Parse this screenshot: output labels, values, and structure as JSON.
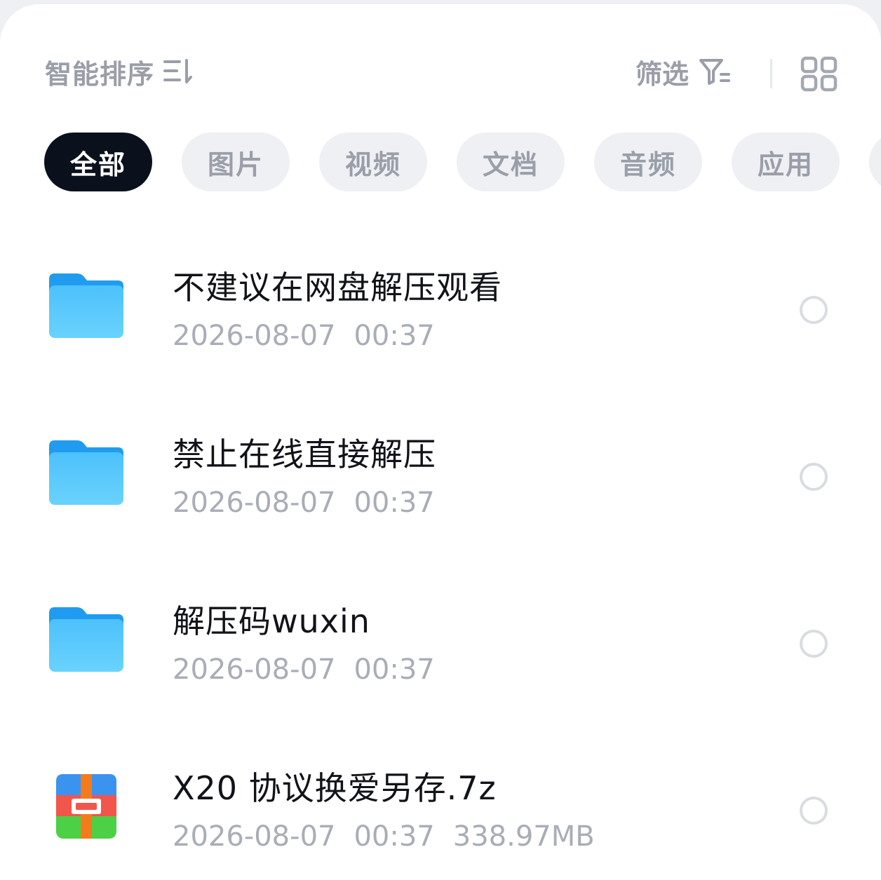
{
  "toolbar": {
    "sort_label": "智能排序",
    "sort_icon": "sort-order-icon",
    "filter_label": "筛选",
    "filter_icon": "filter-icon",
    "view_toggle_icon": "grid-view-icon"
  },
  "categories": [
    {
      "label": "全部",
      "active": true
    },
    {
      "label": "图片",
      "active": false
    },
    {
      "label": "视频",
      "active": false
    },
    {
      "label": "文档",
      "active": false
    },
    {
      "label": "音频",
      "active": false
    },
    {
      "label": "应用",
      "active": false
    }
  ],
  "files": [
    {
      "name": "不建议在网盘解压观看",
      "date": "2026-08-07",
      "time": "00:37",
      "size": "",
      "type": "folder",
      "icon": "folder-icon"
    },
    {
      "name": "禁止在线直接解压",
      "date": "2026-08-07",
      "time": "00:37",
      "size": "",
      "type": "folder",
      "icon": "folder-icon"
    },
    {
      "name": "解压码wuxin",
      "date": "2026-08-07",
      "time": "00:37",
      "size": "",
      "type": "folder",
      "icon": "folder-icon"
    },
    {
      "name": "X20 协议换爱另存.7z",
      "date": "2026-08-07",
      "time": "00:37",
      "size": "338.97MB",
      "type": "archive",
      "icon": "archive-icon"
    }
  ],
  "colors": {
    "accent_chip": "#0b111c",
    "folder_blue": "#3fb6f7",
    "muted_text": "#9a9ea8"
  }
}
